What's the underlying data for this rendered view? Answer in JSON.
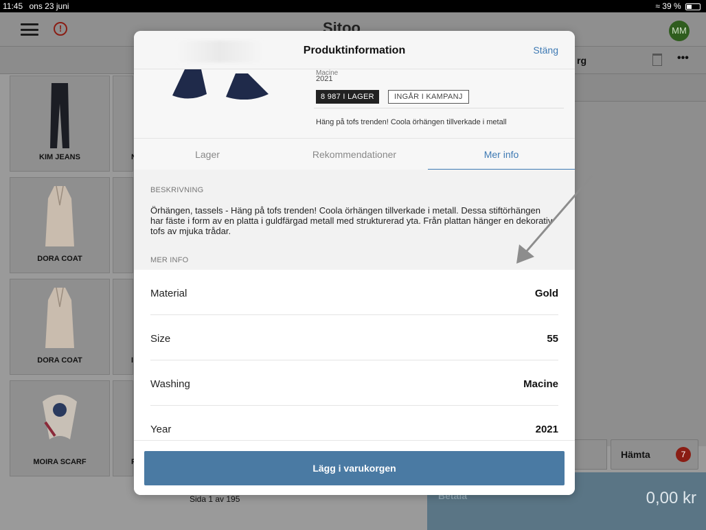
{
  "status": {
    "time": "11:45",
    "date": "ons 23 juni",
    "battery": "39 %"
  },
  "app": {
    "logo": "Sitoo",
    "avatar": "MM",
    "cart_title": "rg",
    "tiles": [
      {
        "name": "KIM JEANS"
      },
      {
        "name": "DORA COAT"
      },
      {
        "name": "DORA COAT"
      },
      {
        "name": "MOIRA SCARF"
      }
    ],
    "tiles_right_letters": [
      "N",
      "",
      "I",
      "F"
    ],
    "pager": "Sida 1 av 195",
    "hamta": {
      "label": "Hämta",
      "badge": "7"
    },
    "pay": {
      "label": "Betala",
      "amount": "0,00 kr"
    }
  },
  "modal": {
    "title": "Produktinformation",
    "close": "Stäng",
    "product": {
      "brand": "Macine",
      "year": "2021",
      "stock": "8 987 I LAGER",
      "campaign": "INGÅR I KAMPANJ",
      "short": "Häng på tofs trenden! Coola örhängen tillverkade i metall"
    },
    "tabs": [
      "Lager",
      "Rekommendationer",
      "Mer info"
    ],
    "description_label": "BESKRIVNING",
    "description": "Örhängen, tassels - Häng på tofs trenden! Coola örhängen tillverkade i metall. Dessa stiftörhängen har fäste i form av en platta i guldfärgad metall med strukturerad yta. Från plattan hänger en dekorativ tofs av mjuka trådar.",
    "more_label": "MER INFO",
    "rows": [
      {
        "key": "Material",
        "value": "Gold"
      },
      {
        "key": "Size",
        "value": "55"
      },
      {
        "key": "Washing",
        "value": "Macine"
      },
      {
        "key": "Year",
        "value": "2021"
      }
    ],
    "add_button": "Lägg i varukorgen"
  },
  "colors": {
    "accent": "#3d79b3",
    "button": "#4a7aa3",
    "alert": "#8a1d14",
    "avatar": "#2f5d1e"
  }
}
